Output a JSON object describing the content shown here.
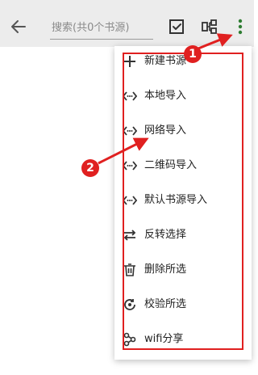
{
  "toolbar": {
    "search_placeholder": "搜索(共0个书源)"
  },
  "menu": {
    "items": [
      {
        "label": "新建书源",
        "icon": "plus-icon"
      },
      {
        "label": "本地导入",
        "icon": "import-code-icon"
      },
      {
        "label": "网络导入",
        "icon": "import-code-icon"
      },
      {
        "label": "二维码导入",
        "icon": "import-code-icon"
      },
      {
        "label": "默认书源导入",
        "icon": "import-code-icon"
      },
      {
        "label": "反转选择",
        "icon": "swap-arrows-icon"
      },
      {
        "label": "删除所选",
        "icon": "trash-icon"
      },
      {
        "label": "校验所选",
        "icon": "refresh-check-icon"
      },
      {
        "label": "wifi分享",
        "icon": "share-icon"
      }
    ]
  },
  "annotations": {
    "badge_1": "1",
    "badge_2": "2",
    "color": "#e02020"
  }
}
